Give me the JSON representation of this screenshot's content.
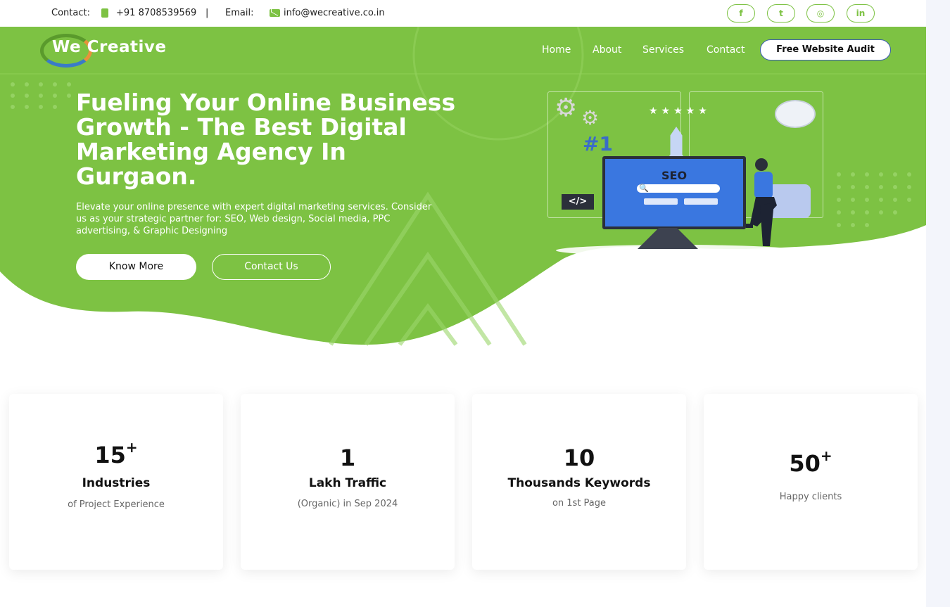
{
  "colors": {
    "brand_green": "#7dc243",
    "white": "#ffffff",
    "text_dark": "#111111",
    "muted": "#666666"
  },
  "topbar": {
    "contact_label": "Contact:",
    "phone": "+91 8708539569",
    "separator": "|",
    "email_label": "Email:",
    "email": "info@wecreative.co.in",
    "social": [
      {
        "icon": "facebook-icon",
        "glyph": "f"
      },
      {
        "icon": "twitter-icon",
        "glyph": "t"
      },
      {
        "icon": "instagram-icon",
        "glyph": "◎"
      },
      {
        "icon": "linkedin-icon",
        "glyph": "in"
      }
    ]
  },
  "header": {
    "logo_text": "We Creative",
    "nav": [
      "Home",
      "About",
      "Services",
      "Contact"
    ],
    "cta": "Free Website Audit"
  },
  "hero": {
    "title": "Fueling Your Online Business Growth - The Best Digital Marketing Agency In Gurgaon.",
    "subtitle": "Elevate your online presence with expert digital marketing services. Consider us as your strategic partner for: SEO, Web design, Social media, PPC advertising, & Graphic Designing",
    "primary_button": "Know More",
    "secondary_button": "Contact Us",
    "illustration": {
      "rank": "#1",
      "monitor_text": "SEO",
      "stars": "★★★★★",
      "code_tag": "</>"
    }
  },
  "stats": [
    {
      "number": "15",
      "suffix": "+",
      "label": "Industries",
      "description": "of Project Experience"
    },
    {
      "number": "1",
      "suffix": "",
      "label": "Lakh Traffic",
      "description": "(Organic) in Sep 2024"
    },
    {
      "number": "10",
      "suffix": "",
      "label": "Thousands Keywords",
      "description": "on 1st Page"
    },
    {
      "number": "50",
      "suffix": "+",
      "label": "",
      "description": "Happy clients"
    }
  ]
}
